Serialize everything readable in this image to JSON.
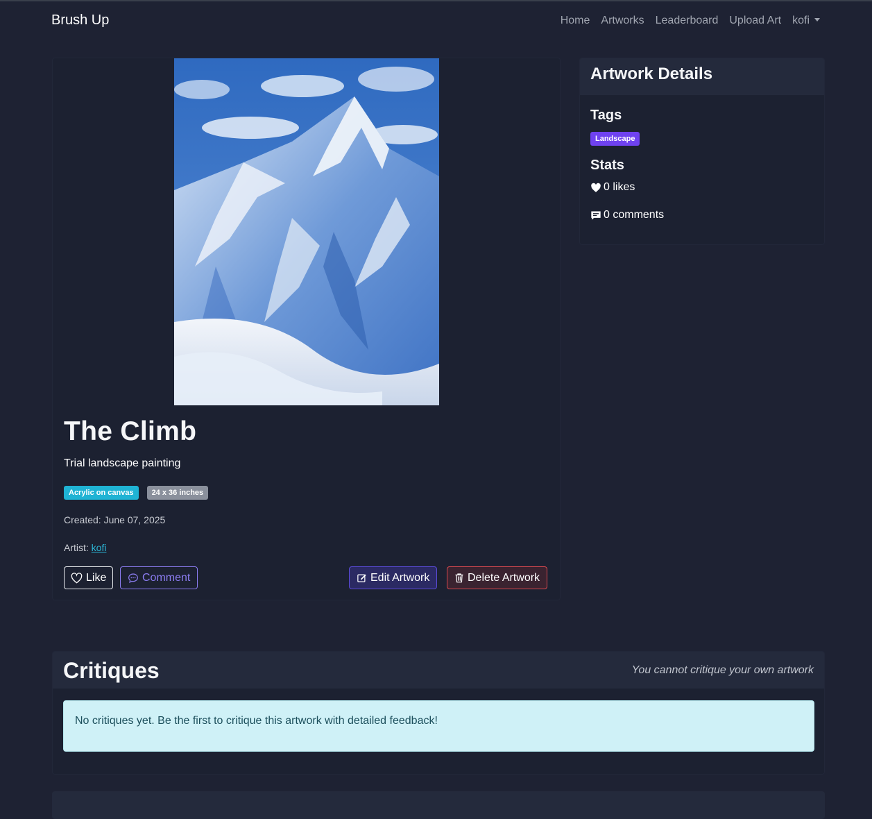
{
  "navbar": {
    "brand": "Brush Up",
    "links": [
      "Home",
      "Artworks",
      "Leaderboard",
      "Upload Art"
    ],
    "user": "kofi"
  },
  "artwork": {
    "title": "The Climb",
    "description": "Trial landscape painting",
    "medium": "Acrylic on canvas",
    "size": "24 x 36 inches",
    "created": "Created: June 07, 2025",
    "artist_label": "Artist:",
    "artist": "kofi",
    "image_icon": "mountain-painting",
    "buttons": {
      "like": "Like",
      "comment": "Comment",
      "edit": "Edit Artwork",
      "delete": "Delete Artwork"
    }
  },
  "details": {
    "header": "Artwork Details",
    "tags_heading": "Tags",
    "tags": [
      "Landscape"
    ],
    "stats_heading": "Stats",
    "likes": "0 likes",
    "comments": "0 comments"
  },
  "critiques": {
    "title": "Critiques",
    "note": "You cannot critique your own artwork",
    "empty_message": "No critiques yet. Be the first to critique this artwork with detailed feedback!"
  },
  "colors": {
    "background": "#1e2233",
    "medium_badge": "#1fb3d4",
    "size_badge": "#8a909c",
    "tag_badge": "#6f42f0",
    "delete": "#d9484f",
    "comment": "#8b7cf0"
  }
}
